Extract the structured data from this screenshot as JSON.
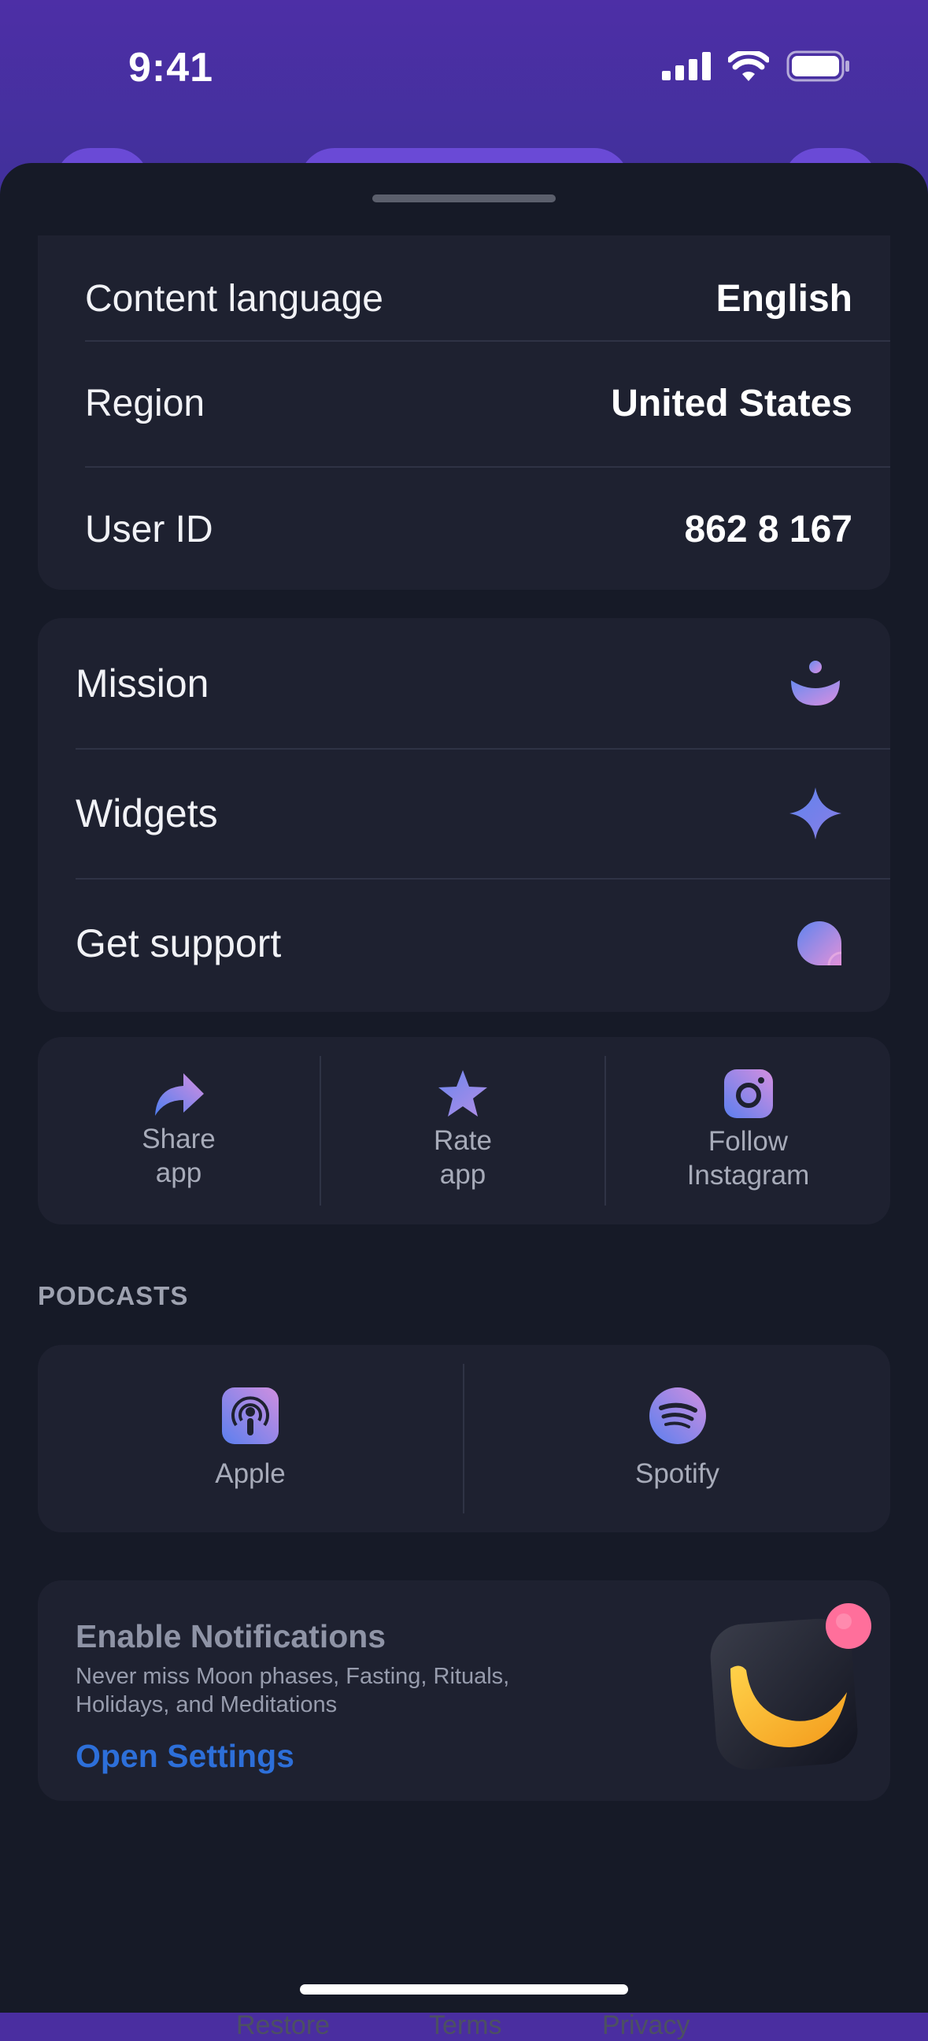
{
  "status_bar": {
    "time": "9:41"
  },
  "settings": {
    "content_language": {
      "label": "Content language",
      "value": "English"
    },
    "region": {
      "label": "Region",
      "value": "United States"
    },
    "user_id": {
      "label": "User ID",
      "value": "862 8 167"
    }
  },
  "menu": {
    "mission": {
      "label": "Mission",
      "icon": "moon-smile-icon"
    },
    "widgets": {
      "label": "Widgets",
      "icon": "sparkle-icon"
    },
    "support": {
      "label": "Get support",
      "icon": "chat-bubble-icon"
    }
  },
  "social": {
    "share": {
      "line1": "Share",
      "line2": "app",
      "icon": "share-arrow-icon"
    },
    "rate": {
      "line1": "Rate",
      "line2": "app",
      "icon": "star-icon"
    },
    "instagram": {
      "line1": "Follow",
      "line2": "Instagram",
      "icon": "instagram-icon"
    }
  },
  "podcasts": {
    "title": "PODCASTS",
    "apple": {
      "label": "Apple",
      "icon": "apple-podcasts-icon"
    },
    "spotify": {
      "label": "Spotify",
      "icon": "spotify-icon"
    }
  },
  "notifications": {
    "title": "Enable Notifications",
    "description": "Never miss Moon phases, Fasting, Rituals, Holidays, and Meditations",
    "link": "Open Settings",
    "illustration": "moon-app-icon"
  },
  "footer": {
    "restore": "Restore",
    "terms": "Terms",
    "privacy": "Privacy"
  },
  "colors": {
    "background": "#161a27",
    "card": "#1e2130",
    "header": "#4a2ea0",
    "link": "#2d6fd9"
  }
}
